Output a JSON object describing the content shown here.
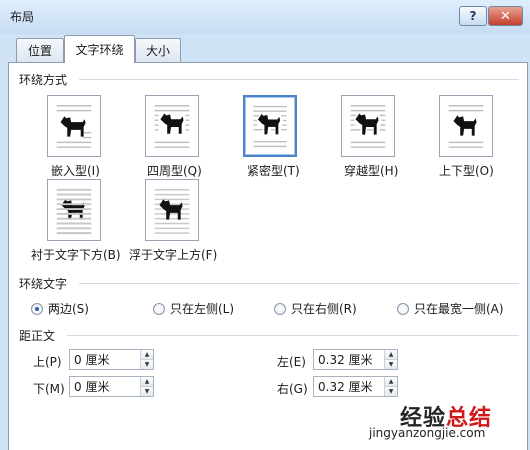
{
  "window": {
    "title": "布局",
    "help_label": "?",
    "close_label": "✕"
  },
  "tabs": [
    {
      "label": "位置"
    },
    {
      "label": "文字环绕",
      "active": true
    },
    {
      "label": "大小"
    }
  ],
  "wrap_style": {
    "title": "环绕方式",
    "options": [
      {
        "label": "嵌入型(I)",
        "icon": "inline-icon"
      },
      {
        "label": "四周型(Q)",
        "icon": "square-icon"
      },
      {
        "label": "紧密型(T)",
        "icon": "tight-icon",
        "selected": true
      },
      {
        "label": "穿越型(H)",
        "icon": "through-icon"
      },
      {
        "label": "上下型(O)",
        "icon": "top-bottom-icon"
      },
      {
        "label": "衬于文字下方(B)",
        "icon": "behind-text-icon"
      },
      {
        "label": "浮于文字上方(F)",
        "icon": "in-front-icon"
      }
    ]
  },
  "wrap_text": {
    "title": "环绕文字",
    "options": [
      {
        "label": "两边(S)",
        "checked": true
      },
      {
        "label": "只在左侧(L)",
        "checked": false
      },
      {
        "label": "只在右侧(R)",
        "checked": false
      },
      {
        "label": "只在最宽一侧(A)",
        "checked": false
      }
    ]
  },
  "distance": {
    "title": "距正文",
    "top": {
      "label": "上(P)",
      "value": "0 厘米"
    },
    "bottom": {
      "label": "下(M)",
      "value": "0 厘米"
    },
    "left": {
      "label": "左(E)",
      "value": "0.32 厘米"
    },
    "right": {
      "label": "右(G)",
      "value": "0.32 厘米"
    }
  },
  "watermark": {
    "main_prefix": "经验",
    "main_suffix": "总结",
    "sub": "jingyanzongjie.com"
  },
  "colors": {
    "selected_border": "#4c84c8",
    "close_button": "#c2402c"
  }
}
